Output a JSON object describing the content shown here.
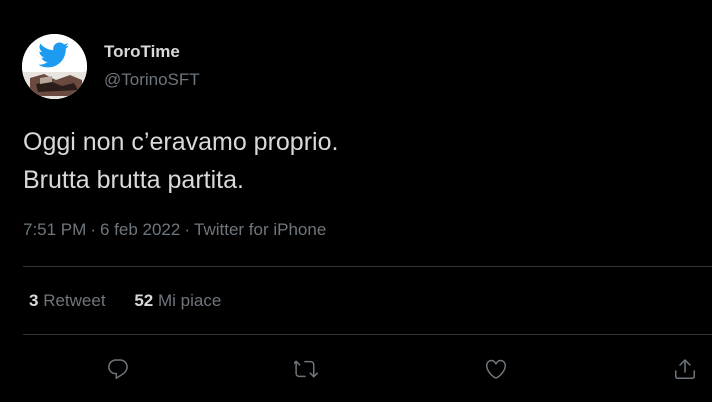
{
  "author": {
    "name": "ToroTime",
    "handle": "@TorinoSFT"
  },
  "tweet": {
    "lines": [
      "Oggi non c’eravamo proprio.",
      "Brutta brutta partita."
    ],
    "time": "7:51 PM",
    "date": "6 feb 2022",
    "source": "Twitter for iPhone",
    "separator": "·"
  },
  "stats": {
    "retweets_count": "3",
    "retweets_label": "Retweet",
    "likes_count": "52",
    "likes_label": "Mi piace"
  },
  "actions": [
    {
      "icon": "reply-icon"
    },
    {
      "icon": "retweet-icon"
    },
    {
      "icon": "like-icon"
    },
    {
      "icon": "share-icon"
    }
  ],
  "colors": {
    "background": "#000000",
    "text": "#d9d9d9",
    "secondary": "#6e767d",
    "twitter_blue": "#1d9bf0",
    "divider": "#2f3336"
  }
}
